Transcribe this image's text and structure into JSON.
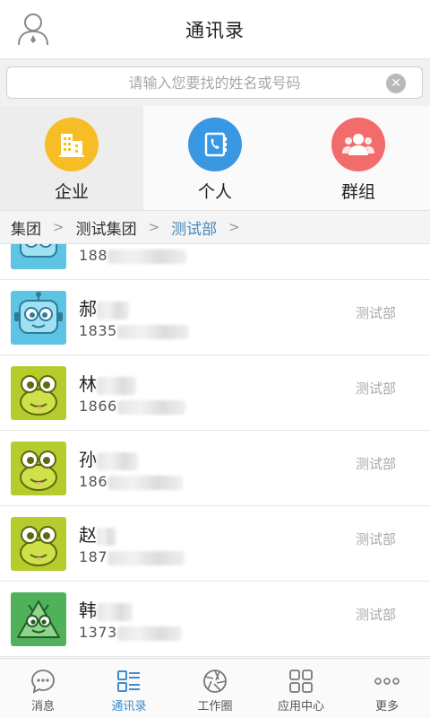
{
  "header": {
    "title": "通讯录"
  },
  "search": {
    "placeholder": "请输入您要找的姓名或号码"
  },
  "categories": [
    {
      "label": "企业",
      "color": "#f6bd27"
    },
    {
      "label": "个人",
      "color": "#3a98e3"
    },
    {
      "label": "群组",
      "color": "#f26c6c"
    }
  ],
  "breadcrumb": [
    "集团",
    "测试集团",
    "测试部"
  ],
  "contacts": [
    {
      "name": "",
      "phone": "188",
      "dept": ""
    },
    {
      "name": "郝",
      "phone": "1835",
      "dept": "测试部"
    },
    {
      "name": "林",
      "phone": "1866",
      "dept": "测试部"
    },
    {
      "name": "孙",
      "phone": "186",
      "dept": "测试部"
    },
    {
      "name": "赵",
      "phone": "187",
      "dept": "测试部"
    },
    {
      "name": "韩",
      "phone": "1373",
      "dept": "测试部"
    }
  ],
  "tabs": [
    {
      "label": "消息"
    },
    {
      "label": "通讯录",
      "active": true
    },
    {
      "label": "工作圈"
    },
    {
      "label": "应用中心"
    },
    {
      "label": "更多"
    }
  ],
  "colors": {
    "accent": "#3d8bd0",
    "breadcrumb_active": "#4a88b9"
  }
}
